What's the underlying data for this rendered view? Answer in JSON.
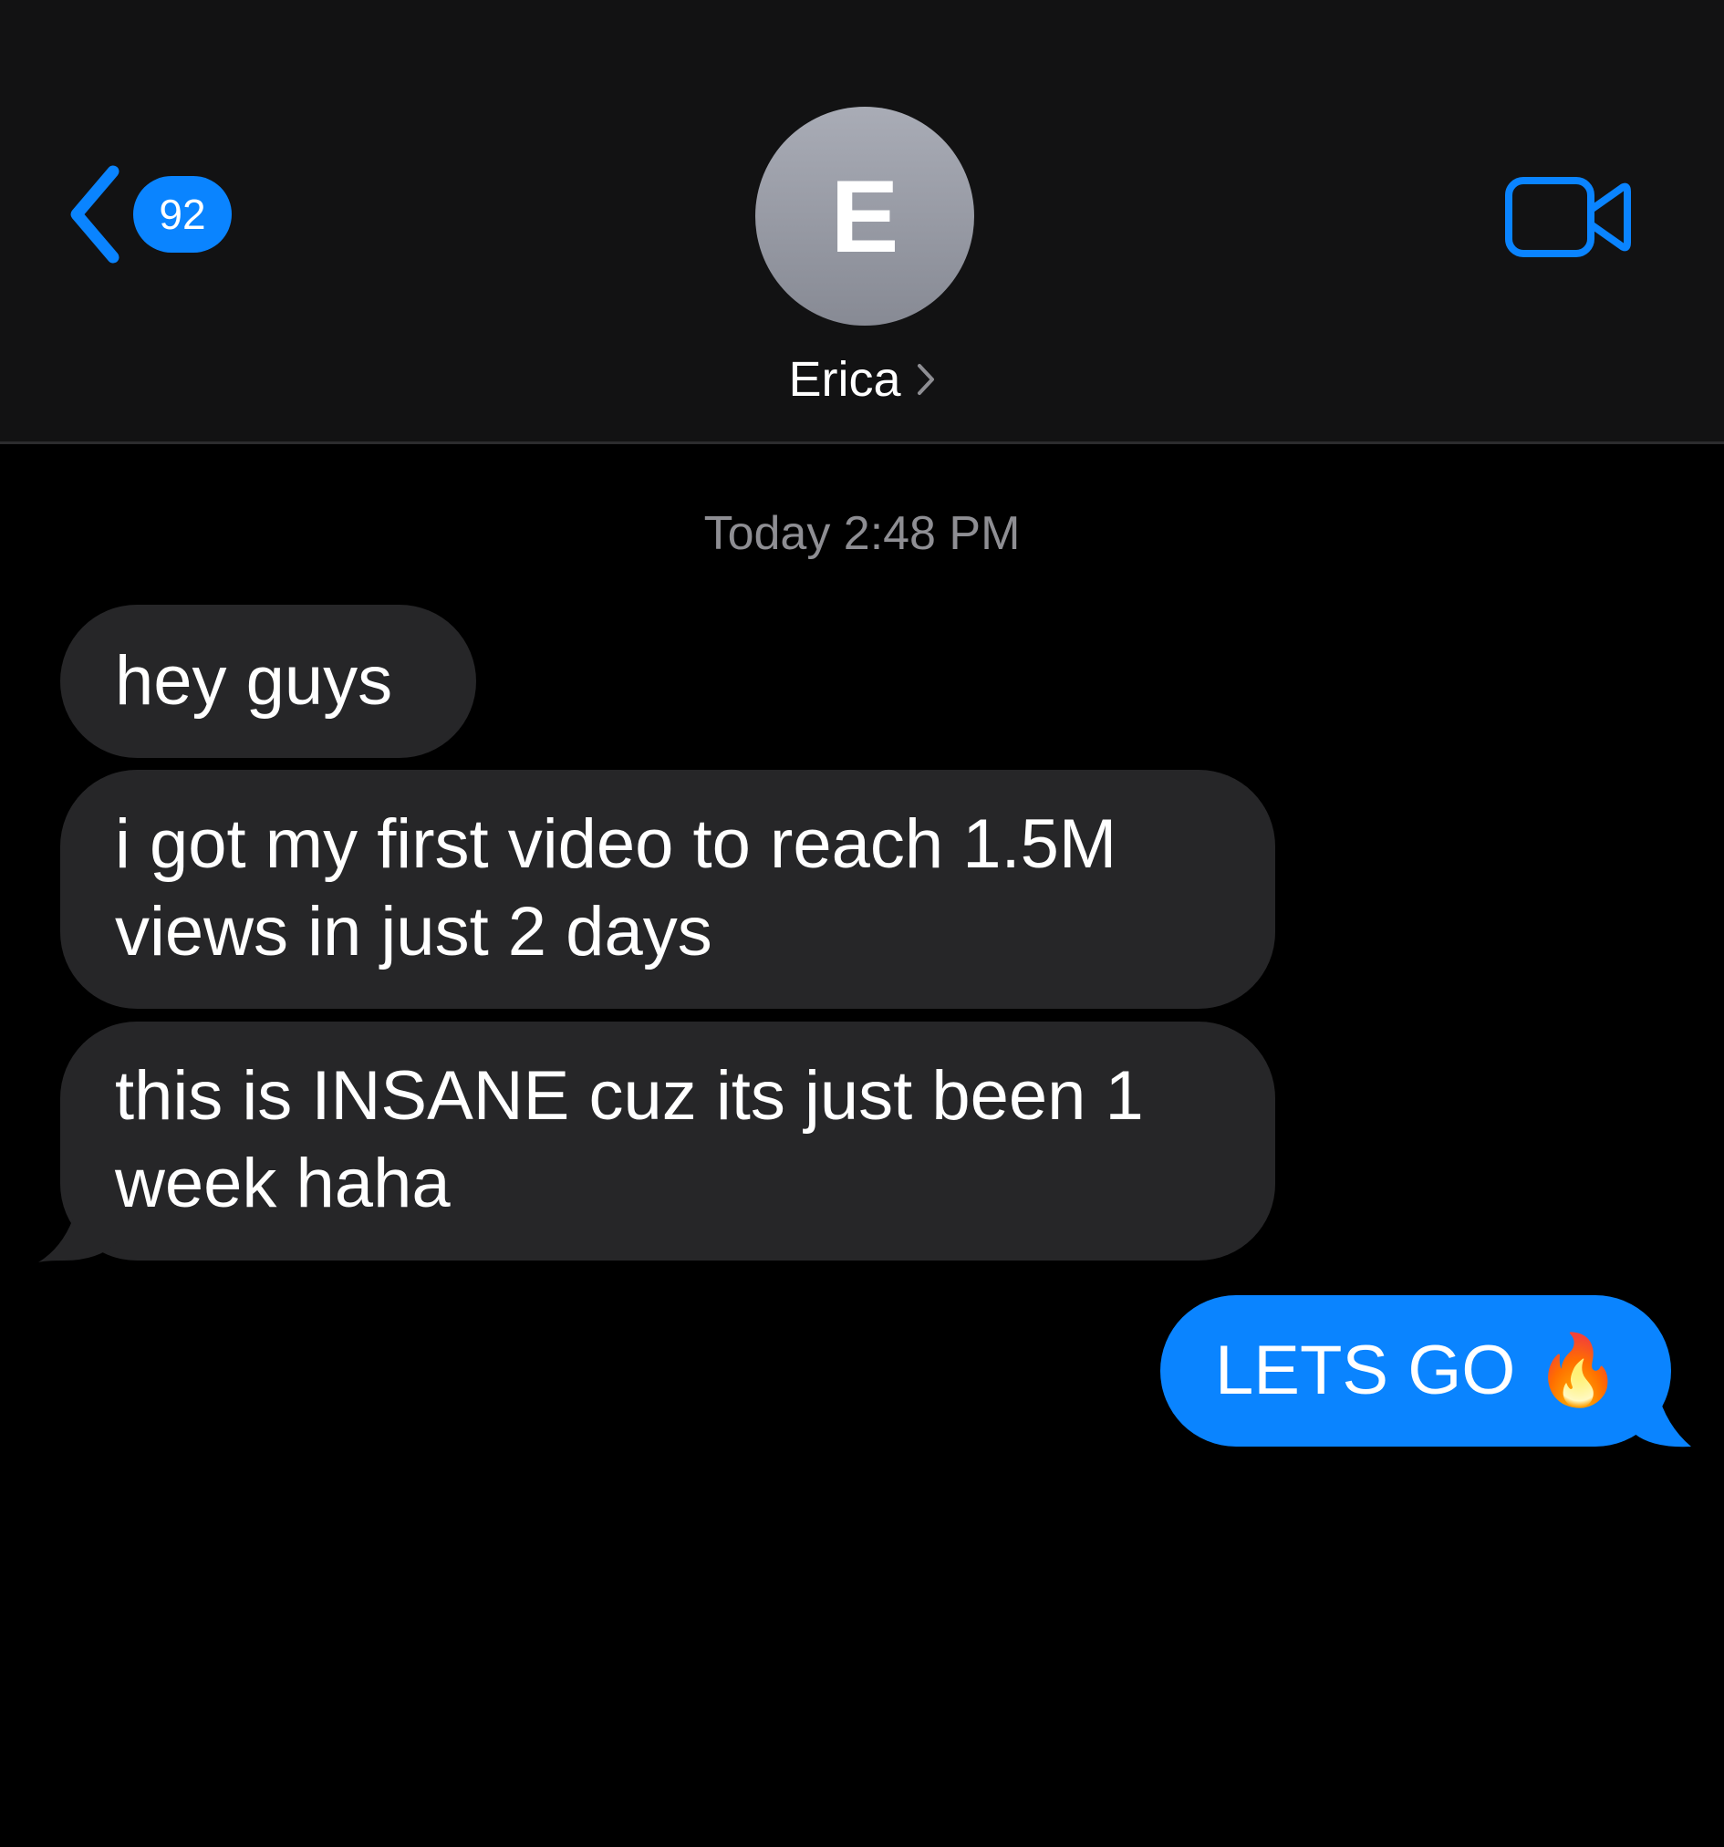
{
  "header": {
    "unread_count": "92",
    "avatar_initial": "E",
    "contact_name": "Erica"
  },
  "thread": {
    "timestamp": "Today 2:48 PM",
    "messages": [
      {
        "direction": "incoming",
        "text": "hey guys"
      },
      {
        "direction": "incoming",
        "text": "i got my first video to reach 1.5M views in just 2 days"
      },
      {
        "direction": "incoming",
        "text": "this is INSANE cuz its just been 1 week haha"
      },
      {
        "direction": "outgoing",
        "text": "LETS GO 🔥"
      }
    ]
  },
  "icons": {
    "back": "chevron-left-icon",
    "contact_details": "chevron-right-icon",
    "facetime": "video-camera-icon"
  },
  "colors": {
    "accent": "#0a84ff",
    "header_bg": "#121213",
    "incoming_bubble": "#262628",
    "background": "#000000",
    "timestamp_text": "#8e8e93"
  }
}
